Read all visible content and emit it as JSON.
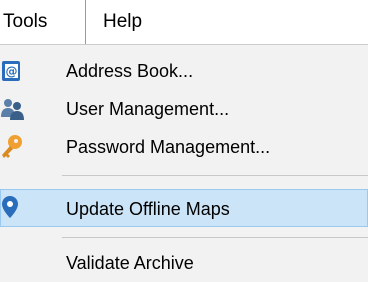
{
  "menubar": {
    "tools_label": "Tools",
    "help_label": "Help"
  },
  "tools_menu": {
    "items": [
      {
        "label": "Address Book...",
        "icon": "address-book-icon"
      },
      {
        "label": "User Management...",
        "icon": "users-icon"
      },
      {
        "label": "Password Management...",
        "icon": "key-icon"
      },
      {
        "label": "Update Offline Maps",
        "icon": "map-pin-icon",
        "highlighted": true
      },
      {
        "label": "Validate Archive",
        "icon": ""
      }
    ]
  },
  "colors": {
    "highlight": "#cce4f7",
    "highlight_border": "#99c9ef",
    "menu_bg": "#f2f2f2",
    "icon_blue": "#2a6ebb",
    "key_orange": "#f0a030"
  }
}
